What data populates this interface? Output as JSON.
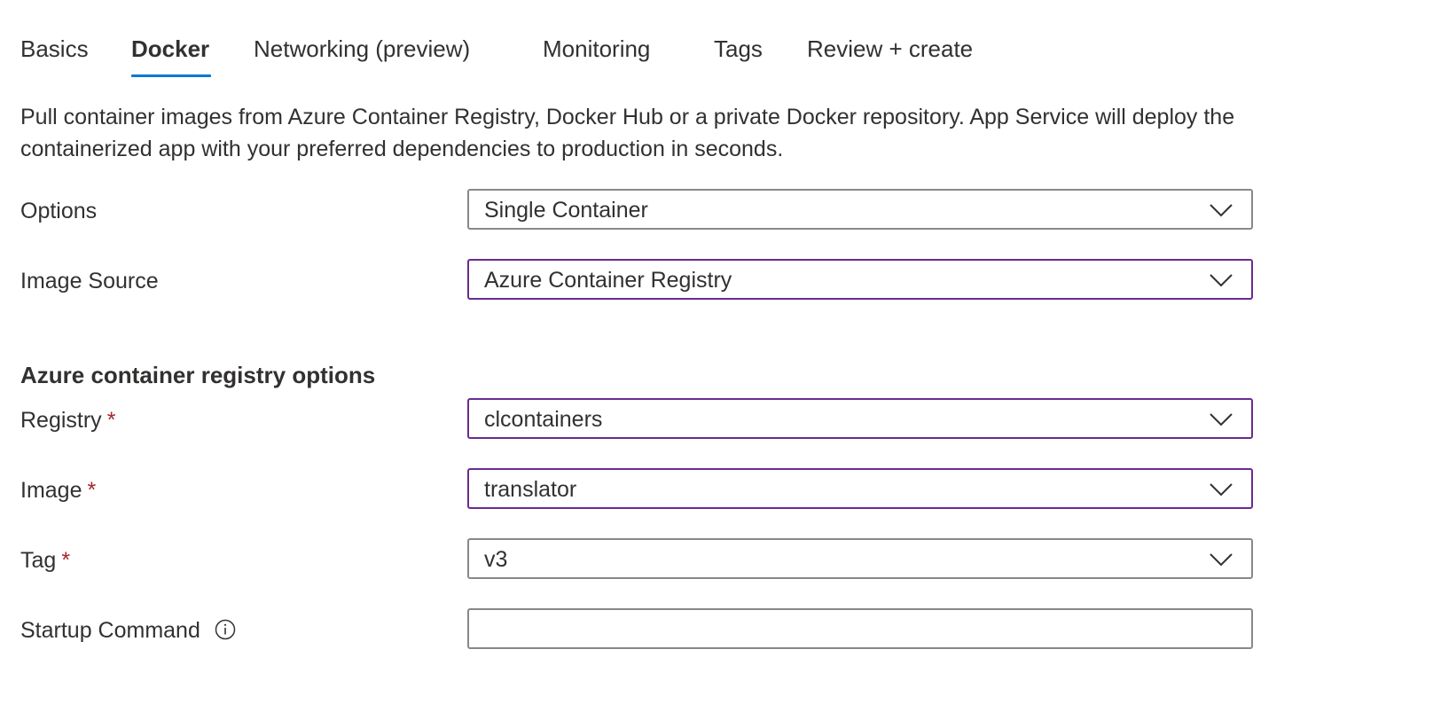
{
  "tabs": [
    {
      "label": "Basics"
    },
    {
      "label": "Docker"
    },
    {
      "label": "Networking (preview)"
    },
    {
      "label": "Monitoring"
    },
    {
      "label": "Tags"
    },
    {
      "label": "Review + create"
    }
  ],
  "active_tab": "Docker",
  "accent_color": "#0078d4",
  "focus_border_color": "#6b2a8f",
  "required_color": "#a4262c",
  "description": "Pull container images from Azure Container Registry, Docker Hub or a private Docker repository. App Service will deploy the containerized app with your preferred dependencies to production in seconds.",
  "options": {
    "label": "Options",
    "value": "Single Container"
  },
  "image_source": {
    "label": "Image Source",
    "value": "Azure Container Registry"
  },
  "acr_section": {
    "heading": "Azure container registry options"
  },
  "registry": {
    "label": "Registry",
    "required_mark": "*",
    "value": "clcontainers"
  },
  "image": {
    "label": "Image",
    "required_mark": "*",
    "value": "translator"
  },
  "tag": {
    "label": "Tag",
    "required_mark": "*",
    "value": "v3"
  },
  "startup_command": {
    "label": "Startup Command",
    "value": "",
    "icon": "info-icon"
  },
  "icons": {
    "dropdown": "chevron-down-icon",
    "info": "info-icon"
  }
}
